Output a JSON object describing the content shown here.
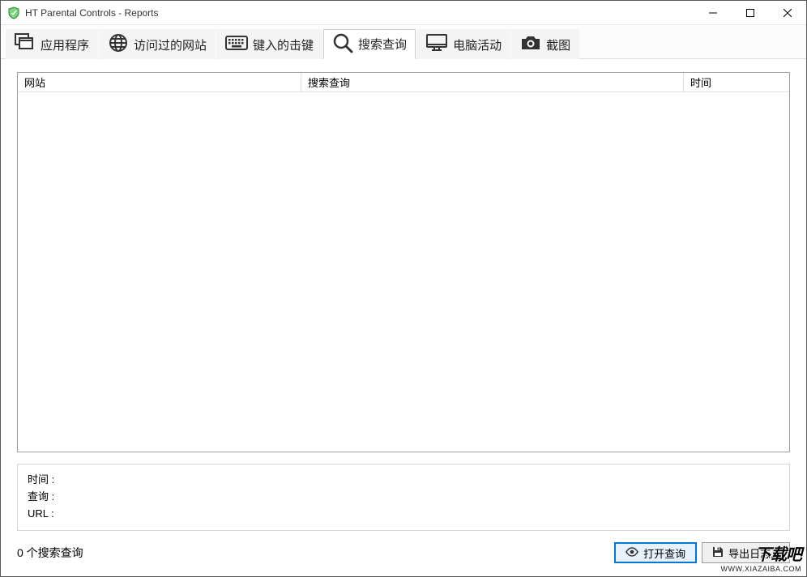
{
  "window": {
    "title": "HT Parental Controls - Reports"
  },
  "tabs": {
    "apps": "应用程序",
    "websites": "访问过的网站",
    "keystrokes": "键入的击键",
    "search": "搜索查询",
    "activity": "电脑活动",
    "screenshots": "截图"
  },
  "table": {
    "col_site": "网站",
    "col_query": "搜索查询",
    "col_time": "时间"
  },
  "details": {
    "time_label": "时间 :",
    "query_label": "查询 :",
    "url_label": "URL :"
  },
  "footer": {
    "count_text": "0 个搜索查询",
    "open_query": "打开查询",
    "export_log": "导出日志..."
  },
  "watermark": {
    "big": "下载吧",
    "small": "WWW.XIAZAIBA.COM"
  }
}
